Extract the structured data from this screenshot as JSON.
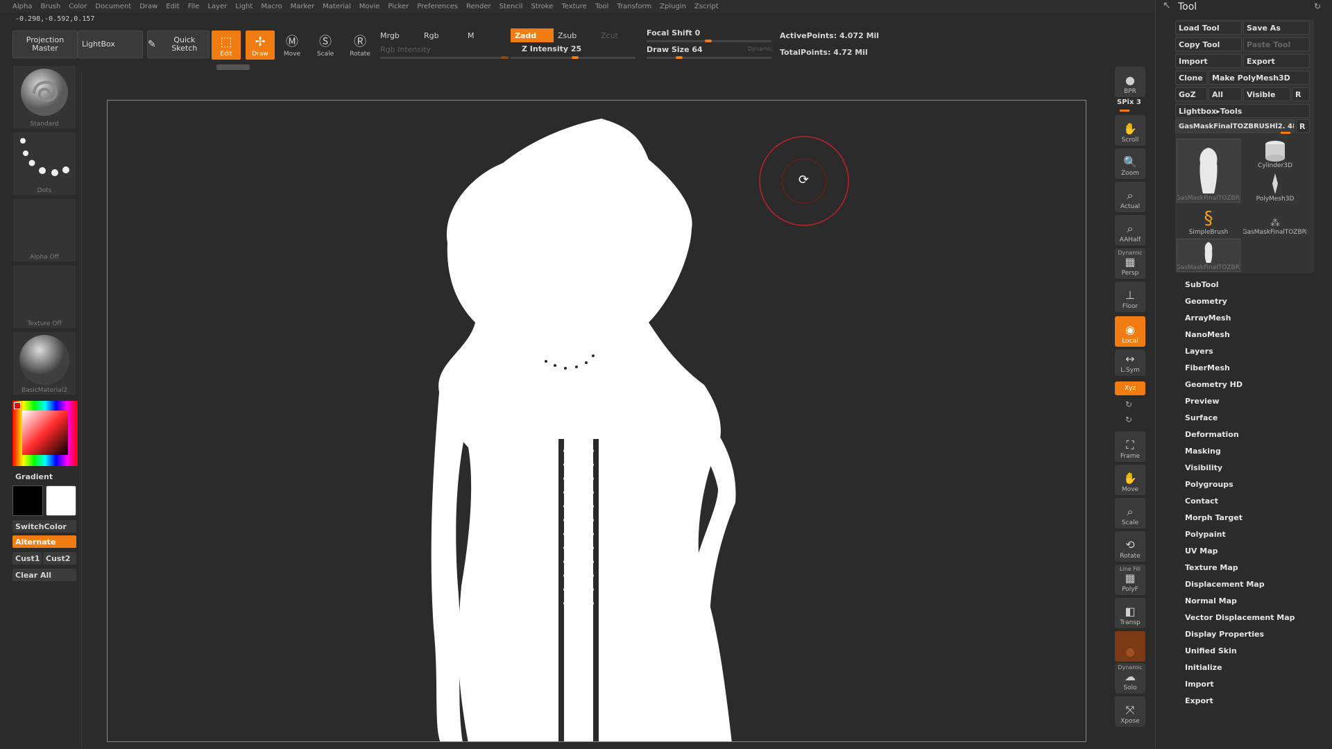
{
  "menu": [
    "Alpha",
    "Brush",
    "Color",
    "Document",
    "Draw",
    "Edit",
    "File",
    "Layer",
    "Light",
    "Macro",
    "Marker",
    "Material",
    "Movie",
    "Picker",
    "Preferences",
    "Render",
    "Stencil",
    "Stroke",
    "Texture",
    "Tool",
    "Transform",
    "Zplugin",
    "Zscript"
  ],
  "coords": "-0.298,-0.592,0.157",
  "shelf": {
    "projection_master": "Projection Master",
    "lightbox": "LightBox",
    "quick_sketch": "Quick Sketch",
    "edit": "Edit",
    "draw": "Draw",
    "move": "Move",
    "scale": "Scale",
    "rotate": "Rotate",
    "mrgb": "Mrgb",
    "rgb": "Rgb",
    "m": "M",
    "rgb_intensity": "Rgb Intensity",
    "zadd": "Zadd",
    "zsub": "Zsub",
    "zcut": "Zcut",
    "z_intensity": "Z Intensity 25",
    "focal_shift": "Focal Shift 0",
    "draw_size": "Draw Size 64",
    "dynamic": "Dynamic",
    "active_points": "ActivePoints: 4.072 Mil",
    "total_points": "TotalPoints: 4.72 Mil"
  },
  "left": {
    "brush_label": "Standard",
    "stroke_label": "Dots",
    "alpha_label": "Alpha Off",
    "texture_label": "Texture Off",
    "material_label": "BasicMaterial2",
    "gradient": "Gradient",
    "switch_color": "SwitchColor",
    "alternate": "Alternate",
    "cust1": "Cust1",
    "cust2": "Cust2",
    "clear_all": "Clear All"
  },
  "right_shelf": {
    "bpr": "BPR",
    "spix": "SPix 3",
    "scroll": "Scroll",
    "zoom": "Zoom",
    "actual": "Actual",
    "aahalf": "AAHalf",
    "dynamic": "Dynamic",
    "persp": "Persp",
    "floor": "Floor",
    "local": "Local",
    "lsym": "L.Sym",
    "xyz": "Xyz",
    "frame": "Frame",
    "move": "Move",
    "scale": "Scale",
    "rotate": "Rotate",
    "line_fill": "Line Fill",
    "polyf": "PolyF",
    "transp": "Transp",
    "solo_dynamic": "Dynamic",
    "solo": "Solo",
    "xpose": "Xpose"
  },
  "tool": {
    "title": "Tool",
    "load_tool": "Load Tool",
    "save_as": "Save As",
    "copy_tool": "Copy Tool",
    "paste_tool": "Paste Tool",
    "import": "Import",
    "export": "Export",
    "clone": "Clone",
    "make_polymesh": "Make PolyMesh3D",
    "goz": "GoZ",
    "all": "All",
    "visible": "Visible",
    "r": "R",
    "lightbox_tools": "Lightbox▸Tools",
    "current_tool": "GasMaskFinalTOZBRUSHl2. 48",
    "thumbs": [
      "GasMaskFinalTOZBRl",
      "Cylinder3D",
      "PolyMesh3D",
      "SimpleBrush",
      "GasMaskFinalTOZBRl",
      "GasMaskFinalTOZBRl"
    ],
    "subpalettes": [
      "SubTool",
      "Geometry",
      "ArrayMesh",
      "NanoMesh",
      "Layers",
      "FiberMesh",
      "Geometry HD",
      "Preview",
      "Surface",
      "Deformation",
      "Masking",
      "Visibility",
      "Polygroups",
      "Contact",
      "Morph Target",
      "Polypaint",
      "UV Map",
      "Texture Map",
      "Displacement Map",
      "Normal Map",
      "Vector Displacement Map",
      "Display Properties",
      "Unified Skin",
      "Initialize",
      "Import",
      "Export"
    ]
  },
  "colors": {
    "accent": "#f07c12",
    "bg": "#2b2b2b",
    "cursor": "#c0202a"
  },
  "icons": {
    "rotate_cursor": "rotate-cursor-icon"
  }
}
